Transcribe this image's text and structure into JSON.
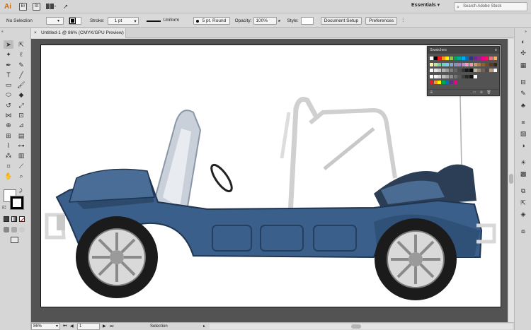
{
  "appbar": {
    "logo": "Ai",
    "bridge_icon": "Br",
    "stock_icon": "St",
    "workspace": "Essentials",
    "search_placeholder": "Search Adobe Stock"
  },
  "control": {
    "selection": "No Selection",
    "stroke_label": "Stroke:",
    "stroke_value": "1 pt",
    "profile_value": "Uniform",
    "brush_value": "5 pt. Round",
    "opacity_label": "Opacity:",
    "opacity_value": "100%",
    "style_label": "Style:",
    "doc_setup": "Document Setup",
    "preferences": "Preferences"
  },
  "tab": {
    "title": "Untitled-1 @ 86% (CMYK/GPU Preview)",
    "close": "×"
  },
  "status": {
    "zoom": "86%",
    "artboard": "1",
    "mode": "Selection"
  },
  "swatches": {
    "title": "Swatches",
    "rows": [
      [
        "#ffffff",
        "#000000",
        "#ed1c24",
        "#f7941d",
        "#fff200",
        "#8dc63f",
        "#00a651",
        "#00a99d",
        "#00aeef",
        "#0072bc",
        "#2e3192",
        "#662d91",
        "#92278f",
        "#ec008c",
        "#ed145b",
        "#f26d7d",
        "#fbaf5d"
      ],
      [
        "#fff799",
        "#c4df9b",
        "#82ca9c",
        "#7accc8",
        "#6dcff6",
        "#7da7d9",
        "#8393ca",
        "#a186be",
        "#bd8cbf",
        "#f49ac1",
        "#f5989d",
        "#c69c6d",
        "#a67c52",
        "#8c6239",
        "#754c24",
        "#603913",
        "#3c2415"
      ],
      [
        "#ffffff",
        "#e6e6e6",
        "#cccccc",
        "#b3b3b3",
        "#999999",
        "#808080",
        "#666666",
        "#4d4d4d",
        "#333333",
        "#1a1a1a",
        "#000000",
        "#c7b299",
        "#998675",
        "#736357",
        "#534741",
        "#c69c6d",
        "#ffffff"
      ],
      [
        "#ffffff",
        "#f2f2f2",
        "#d9d9d9",
        "#bfbfbf",
        "#a6a6a6",
        "#8c8c8c",
        "#737373",
        "#595959",
        "#404040",
        "#262626",
        "#0d0d0d",
        "#ffffff"
      ],
      [
        "#ed1c24",
        "#f7941d",
        "#fff200",
        "#00a651",
        "#0072bc",
        "#662d91",
        "#ec008c"
      ]
    ]
  },
  "colors": {
    "jeep_body": "#3a5f8a",
    "jeep_dark": "#1f3550",
    "tire": "#2b2b2b",
    "chrome": "#d9d9d9"
  },
  "icons": {
    "workspace_arrow": "chevron-down-icon",
    "search": "search-icon"
  }
}
